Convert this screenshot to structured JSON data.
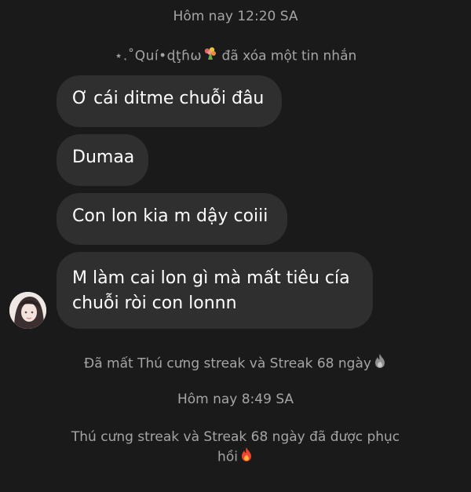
{
  "chat": {
    "timestamp_1": "Hôm nay 12:20 SA",
    "deleted_notice": {
      "user": "⋆.˚Quí•ɖţɦω",
      "text": "đã xóa một tin nhắn"
    },
    "messages": [
      {
        "lines": [
          "Ơ cái ditme chuỗi đâu"
        ]
      },
      {
        "lines": [
          "Dumaa"
        ]
      },
      {
        "lines": [
          "Con lon kia m dậy coiii"
        ]
      },
      {
        "lines": [
          "M làm cai lon gì mà mất tiêu cía",
          "chuỗi ròi con lonnn"
        ]
      }
    ],
    "streak_lost": "Đã mất Thú cưng streak và Streak 68 ngày",
    "timestamp_2": "Hôm nay 8:49 SA",
    "streak_restored": {
      "line1": "Thú cưng streak và Streak 68 ngày đã được phục",
      "line2": "hồi"
    }
  },
  "colors": {
    "background": "#1a1a1a",
    "bubble": "#2f2f2f",
    "system_text": "#a5a5a5",
    "message_text": "#ffffff"
  },
  "icons": [
    "bouquet-icon",
    "gray-fire-icon",
    "fire-icon",
    "avatar"
  ]
}
